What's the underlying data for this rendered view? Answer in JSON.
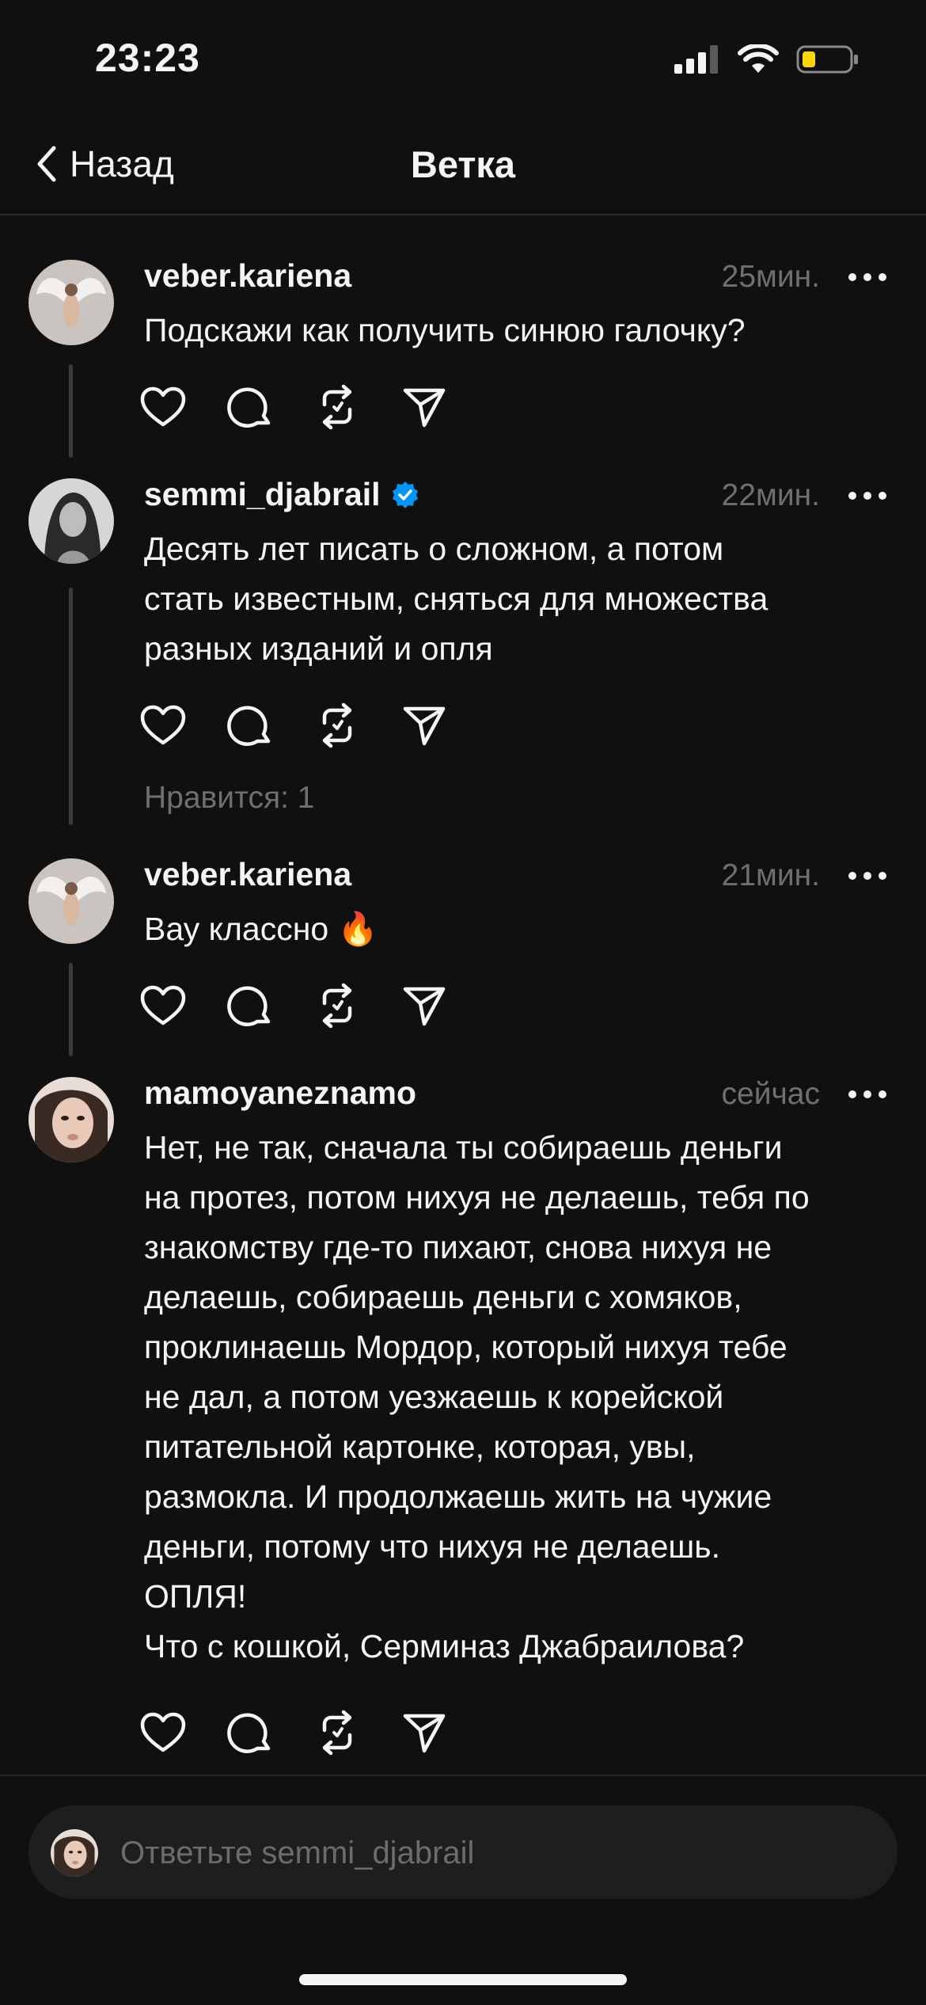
{
  "status": {
    "time": "23:23"
  },
  "nav": {
    "back_label": "Назад",
    "title": "Ветка"
  },
  "posts": [
    {
      "username": "veber.kariena",
      "verified": false,
      "time": "25мин.",
      "text": "Подскажи как получить синюю галочку?",
      "avatar_icon": "angel-wings-photo"
    },
    {
      "username": "semmi_djabrail",
      "verified": true,
      "time": "22мин.",
      "text": "Десять лет писать о сложном, а потом\nстать известным, сняться для множества\nразных изданий и опля",
      "likes": "Нравится: 1",
      "avatar_icon": "woman-portrait-bw"
    },
    {
      "username": "veber.kariena",
      "verified": false,
      "time": "21мин.",
      "text": "Вау классно 🔥",
      "avatar_icon": "angel-wings-photo"
    },
    {
      "username": "mamoyaneznamo",
      "verified": false,
      "time": "сейчас",
      "text": "Нет, не так, сначала ты собираешь деньги\nна протез, потом нихуя не делаешь, тебя по\nзнакомству где-то пихают, снова нихуя не\nделаешь, собираешь деньги с хомяков,\nпроклинаешь Мордор, который нихуя тебе\nне дал, а потом уезжаешь к корейской\nпитательной картонке, которая, увы,\nразмокла. И продолжаешь жить на чужие\nденьги, потому что нихуя не делаешь.\nОПЛЯ!\nЧто с кошкой, Серминаз Джабраилова?",
      "avatar_icon": "selfie-portrait"
    }
  ],
  "reply": {
    "placeholder": "Ответьте semmi_djabrail"
  },
  "colors": {
    "background": "#101010",
    "text": "#f3f5f7",
    "muted": "#6f6f6f",
    "verified": "#0095f6",
    "battery": "#ffd60a"
  }
}
